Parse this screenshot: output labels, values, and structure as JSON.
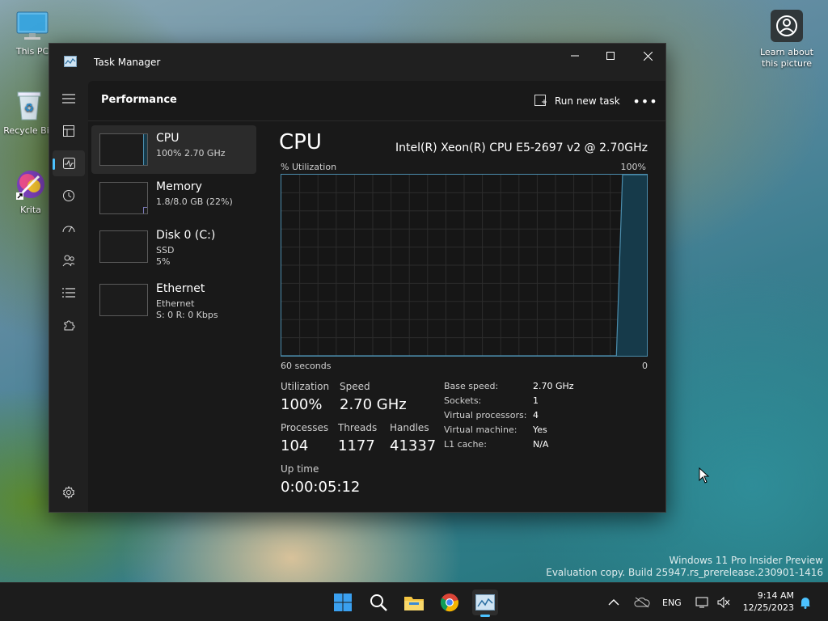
{
  "desktop": {
    "icons": [
      {
        "label": "This PC"
      },
      {
        "label": "Recycle Bin"
      },
      {
        "label": "Krita"
      }
    ],
    "learn_label": "Learn about this picture",
    "watermark_line1": "Windows 11 Pro Insider Preview",
    "watermark_line2": "Evaluation copy. Build 25947.rs_prerelease.230901-1416"
  },
  "window": {
    "title": "Task Manager",
    "header_title": "Performance",
    "run_new_task": "Run new task",
    "more": "•••"
  },
  "perf_list": [
    {
      "name": "CPU",
      "line1": "100%  2.70 GHz",
      "line2": "",
      "usage": 1.0
    },
    {
      "name": "Memory",
      "line1": "1.8/8.0 GB (22%)",
      "line2": "",
      "usage": 0.22
    },
    {
      "name": "Disk 0 (C:)",
      "line1": "SSD",
      "line2": "5%",
      "usage": 0.05
    },
    {
      "name": "Ethernet",
      "line1": "Ethernet",
      "line2": "S: 0  R: 0 Kbps",
      "usage": 0
    }
  ],
  "cpu": {
    "title": "CPU",
    "model": "Intel(R) Xeon(R) CPU E5-2697 v2 @ 2.70GHz",
    "util_label": "% Utilization",
    "util_max": "100%",
    "x_left": "60 seconds",
    "x_right": "0",
    "stats": {
      "utilization_label": "Utilization",
      "utilization": "100%",
      "speed_label": "Speed",
      "speed": "2.70 GHz",
      "processes_label": "Processes",
      "processes": "104",
      "threads_label": "Threads",
      "threads": "1177",
      "handles_label": "Handles",
      "handles": "41337",
      "uptime_label": "Up time",
      "uptime": "0:00:05:12"
    },
    "details": [
      {
        "label": "Base speed:",
        "value": "2.70 GHz"
      },
      {
        "label": "Sockets:",
        "value": "1"
      },
      {
        "label": "Virtual processors:",
        "value": "4"
      },
      {
        "label": "Virtual machine:",
        "value": "Yes"
      },
      {
        "label": "L1 cache:",
        "value": "N/A"
      }
    ],
    "history": [
      0,
      0,
      0,
      0,
      0,
      0,
      0,
      0,
      0,
      0,
      0,
      0,
      0,
      0,
      0,
      0,
      0,
      0,
      0,
      0,
      0,
      0,
      0,
      0,
      0,
      0,
      0,
      0,
      0,
      0,
      0,
      0,
      0,
      0,
      0,
      0,
      0,
      0,
      0,
      0,
      0,
      0,
      0,
      0,
      0,
      0,
      0,
      0,
      0,
      0,
      0,
      0,
      0,
      0,
      0,
      0,
      100,
      100,
      100,
      100,
      100
    ]
  },
  "taskbar": {
    "lang": "ENG",
    "time": "9:14 AM",
    "date": "12/25/2023"
  },
  "colors": {
    "accent": "#4cc2ff",
    "graph_line": "#4b8dad",
    "graph_fill": "#163a4a",
    "window_bg": "#202020"
  }
}
